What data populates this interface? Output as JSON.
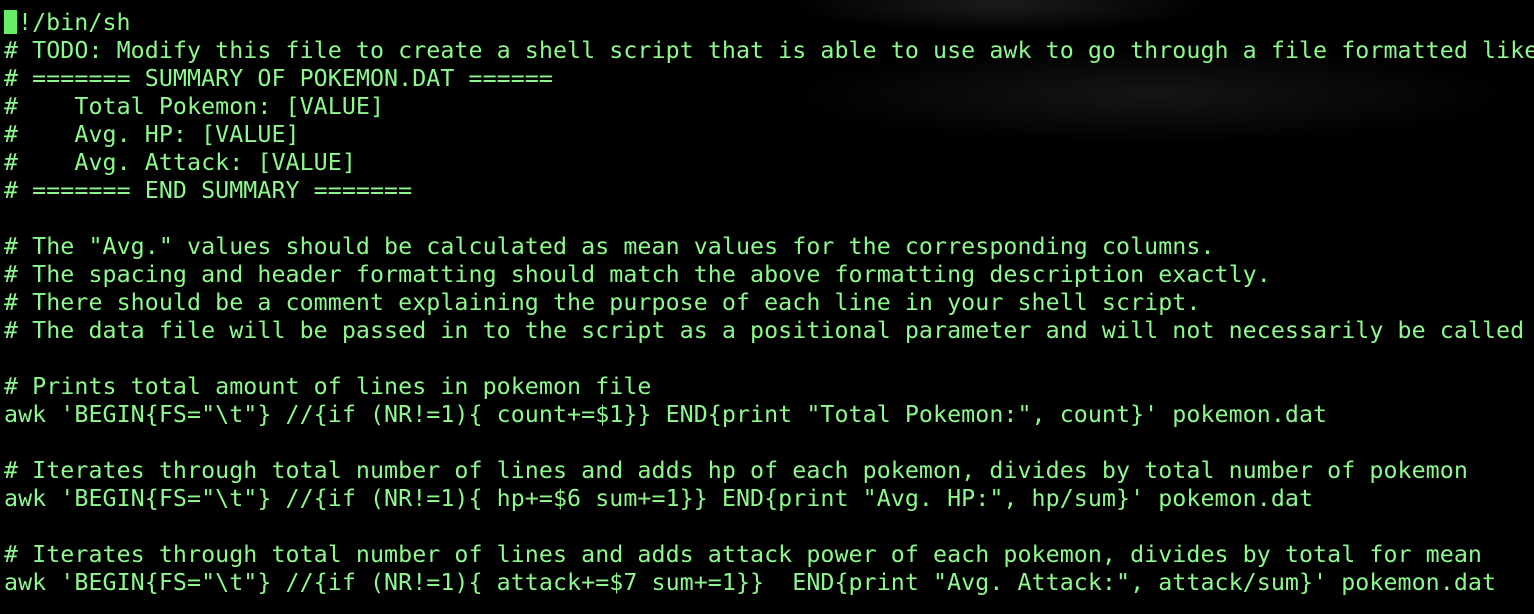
{
  "editor": {
    "lines": [
      "!/bin/sh",
      "# TODO: Modify this file to create a shell script that is able to use awk to go through a file formatted like",
      "# ======= SUMMARY OF POKEMON.DAT ======",
      "#    Total Pokemon: [VALUE]",
      "#    Avg. HP: [VALUE]",
      "#    Avg. Attack: [VALUE]",
      "# ======= END SUMMARY =======",
      "",
      "# The \"Avg.\" values should be calculated as mean values for the corresponding columns.",
      "# The spacing and header formatting should match the above formatting description exactly.",
      "# There should be a comment explaining the purpose of each line in your shell script.",
      "# The data file will be passed in to the script as a positional parameter and will not necessarily be called p",
      "",
      "# Prints total amount of lines in pokemon file",
      "awk 'BEGIN{FS=\"\\t\"} //{if (NR!=1){ count+=$1}} END{print \"Total Pokemon:\", count}' pokemon.dat",
      "",
      "# Iterates through total number of lines and adds hp of each pokemon, divides by total number of pokemon",
      "awk 'BEGIN{FS=\"\\t\"} //{if (NR!=1){ hp+=$6 sum+=1}} END{print \"Avg. HP:\", hp/sum}' pokemon.dat",
      "",
      "# Iterates through total number of lines and adds attack power of each pokemon, divides by total for mean",
      "awk 'BEGIN{FS=\"\\t\"} //{if (NR!=1){ attack+=$7 sum+=1}}  END{print \"Avg. Attack:\", attack/sum}' pokemon.dat"
    ]
  },
  "colors": {
    "background": "#000000",
    "text": "#8ef88e",
    "cursor": "#66ee66"
  }
}
